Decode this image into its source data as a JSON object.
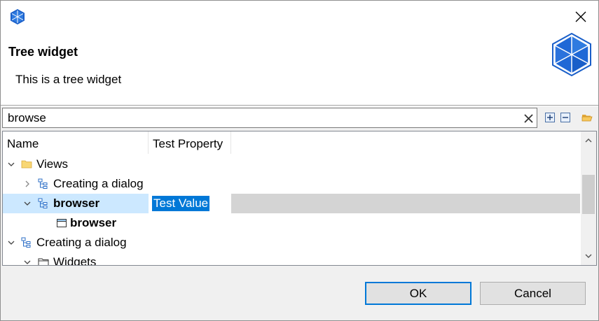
{
  "header": {
    "title": "Tree widget",
    "description": "This is a tree widget"
  },
  "filter": {
    "value": "browse"
  },
  "toolbar": {
    "icons": [
      "expand-all-icon",
      "collapse-all-icon",
      "folder-open-icon"
    ]
  },
  "tree": {
    "columns": [
      "Name",
      "Test Property"
    ],
    "rows": [
      {
        "label": "Views",
        "expanded": true,
        "icon": "folder-icon",
        "value": ""
      },
      {
        "label": "Creating a dialog",
        "expanded": false,
        "icon": "tree-item-icon",
        "value": ""
      },
      {
        "label": "browser",
        "expanded": true,
        "icon": "tree-item-icon",
        "value": "Test Value",
        "selected": true
      },
      {
        "label": "browser",
        "icon": "window-icon",
        "value": ""
      },
      {
        "label": "Creating a dialog",
        "expanded": true,
        "icon": "tree-item-icon",
        "value": ""
      },
      {
        "label": "Widgets",
        "expanded": true,
        "icon": "folder-outline-icon",
        "value": ""
      }
    ]
  },
  "buttons": {
    "ok": "OK",
    "cancel": "Cancel"
  },
  "colors": {
    "accent": "#0078d7",
    "selection": "#cce8ff",
    "logo_blue": "#1a5fc9"
  }
}
